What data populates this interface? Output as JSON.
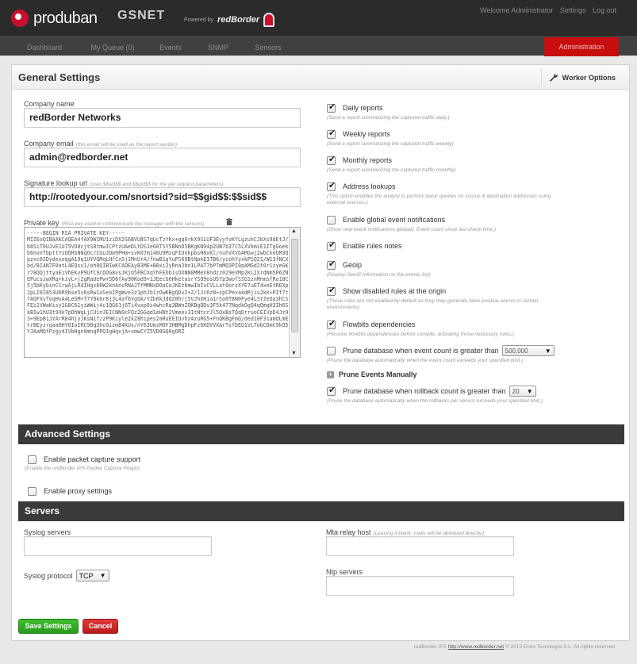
{
  "header": {
    "brand": "produban",
    "brand2": "GSNET",
    "powered_by": "Powered by",
    "powered_brand": "redBorder",
    "welcome": "Welcome Administrator",
    "settings_link": "Settings",
    "logout_link": "Log out"
  },
  "nav": {
    "tabs": [
      "Dashboard",
      "My Queue (0)",
      "Events",
      "SNMP",
      "Sensors"
    ],
    "admin_tab": "Administration"
  },
  "panel": {
    "title": "General Settings",
    "worker_options": "Worker Options"
  },
  "form": {
    "company_name_label": "Company name",
    "company_name": "redBorder Networks",
    "company_email_label": "Company email",
    "company_email_hint": "(this email will be used as the report sender)",
    "company_email": "admin@redborder.net",
    "signature_label": "Signature lookup url",
    "signature_hint": "(user $$sid$$ and $$gid$$ for the get request parameters)",
    "signature_url": "http://rootedyour.com/snortsid?sid=$$gid$$:$$sid$$",
    "private_key_label": "Private key",
    "private_key_hint": "(RSA key used to communicate the manager with the sensors)",
    "private_key": "-----BEGIN RSA PRIVATE KEY-----\nMIIEoQIBAAKCAQEA4fAX9W1MU1ziDX2S6BVU8S7qUcTzYKx+gq6rkX9SLUF3EyyfvKYLgzuhCJbXs9dEtJ/b8SiT0UJvE1U75VO8cjtS8tmwICPtzUAeDLtDS1eG0TSY5BNnD5BKgKN94p2UB7bI7C5LXVkmiE1ITgGoekb6noV7bpttYsQQHSNNqOc/CUuJDw9PHm+svK07m146U9MzqFIUnkpbsH8xKl/nuhVXVbAMowj2wbCkebM3Qpzxc0IDydexoqgA19q1UYVGMqLHfCx5j1MnUrA/fnwB1gYuPS69BtNpkE1TB6/ycohYyxkPSQ21/W13fNCXbd/BI4N7F0atL4EQsv1/oh8QIBIwKCAQEAyB3ME+BBxi2yRnaJbn1LPAT7bP7mMQ3PI0pAMGd2f0r1zyeGKr78QQjttyaEiVhEKvP9UfC9cDOG8vsJKjQ5P8CXqYhFEOb1sOXNN0MMeV8ndzz029eVMp2KLIXrdNm5P6ZNEPucszwXRq+kiyL+j2gRaUePw+5D6fAy90Kod9+1JEecG6HketasrYSQ9osU57p3wofSSG1znMnmsfRo18C5j5bKybinCCrwAjLR4IHgx66W2knAncRNAJTfMMNxDOaCoJKEzbmwIbIuCVLLat0orzXYE7uET4xeEtREXp2pLI6I853U6R9bse5v6sRw1xSeoIPgWve3z1phJb1rOwKBgQDxI+Z/1Jc6z8+zpCPevakdRjis2kk+PZf7t7AOFXvToqHvA4LeSM+T7Y8k6r8j3L4af6VgOA/YZb6kJdQZ0hrj5VJhXHia1rSo0T8N0Fye4LSYZeOa3hCSFEi1VWaKisy1G0C61yiWWij4c1QG61j6Ti4vxp0i4whcRq3BWnZQKBgQDv3F5k477NqdkOgQ4qQmgH3Ih6SkBIw1hU3t9Xk7pDhWgLjCUinJEICNN9cFQz2GGqd1eHNt2Vmeev31tNtcrJl5QxBsTQqDrruoCEIVpD4Jz93+9EpB1JYArR84hjyJKsN1f/zP9KiyleZkZ8hipes2aRuEEIUvhz4zuRG5+FnQKBgFmQ/ded10F31amdLmEtrBEyzrqaa0HY0IoIRC98q3hcOizm84KUs/nY63UmzMOF3HBMgDhpFz6KDVVXArTsfDEU1VLTobCDmC9kQ5YJAaMQfPzgy4IVbHgn9mnqPPQ1gHqxjA+smwCYZ5VD8GQ8gORZ"
  },
  "options": [
    {
      "label": "Daily reports",
      "checked": true,
      "desc": "(Send a report summarizing the captured traffic daily.)"
    },
    {
      "label": "Weekly reports",
      "checked": true,
      "desc": "(Send a report summarizing the captured traffic weekly)"
    },
    {
      "label": "Monthly reports",
      "checked": true,
      "desc": "(Send a report summarizing the captured traffic monthly)"
    },
    {
      "label": "Address lookups",
      "checked": true,
      "desc": "(This option enables the analyst to perform basic queries on source & destination addresses using external sources.)"
    },
    {
      "label": "Enable global event notifications",
      "checked": false,
      "desc": "(Show new event notifications globally. Event count since last check time.)"
    },
    {
      "label": "Enable rules notes",
      "checked": true,
      "desc": ""
    },
    {
      "label": "Geoip",
      "checked": true,
      "desc": "(Display GeoIP information on the events list)"
    },
    {
      "label": "Show disabled rules at the origin",
      "checked": true,
      "desc": "(These rules are not enabled by default as they may generate false positive alarms in certain environments)"
    },
    {
      "label": "Flowbits dependencies",
      "checked": true,
      "desc": "(Resolve flowbits dependencies before compile, activating those necessary rules.)"
    }
  ],
  "prune_event": {
    "label": "Prune database when event count is greater than",
    "checked": false,
    "value": "500,000",
    "desc": "(Prune the database automatically when the event count exceeds your specified limit.)"
  },
  "prune_manual": "Prune Events Manually",
  "prune_rollback": {
    "label": "Prune database when rollback count is greater than",
    "checked": true,
    "value": "20",
    "desc": "(Prune the database automatically when the rollbacks per sensor exceeds your specified limit.)"
  },
  "advanced": {
    "title": "Advanced Settings",
    "packet_capture": "Enable packet capture support",
    "packet_capture_desc": "(Enable the redBorder IPS Packet Capture Plugin)",
    "proxy": "Enable proxy settings"
  },
  "servers": {
    "title": "Servers",
    "syslog_label": "Syslog servers",
    "syslog_value": "",
    "syslog_protocol_label": "Syslog protocol",
    "syslog_protocol": "TCP",
    "mta_label": "Mta relay host",
    "mta_hint": "(Leaving it blank, mails will be delivered directly.)",
    "mta_value": "",
    "ntp_label": "Ntp servers",
    "ntp_value": ""
  },
  "buttons": {
    "save": "Save Settings",
    "cancel": "Cancel"
  },
  "footer": {
    "prefix": "redBorder IPS",
    "link": "http://www.redborder.net",
    "suffix": "© 2013 Eneo Tecnología S.L. All rights reserved"
  },
  "colors": {
    "header_bg": "#2b2b2b",
    "admin_tab": "#c70d0d",
    "section_bar": "#3a3a3a",
    "save": "#2fa823",
    "cancel": "#d02a2a"
  }
}
